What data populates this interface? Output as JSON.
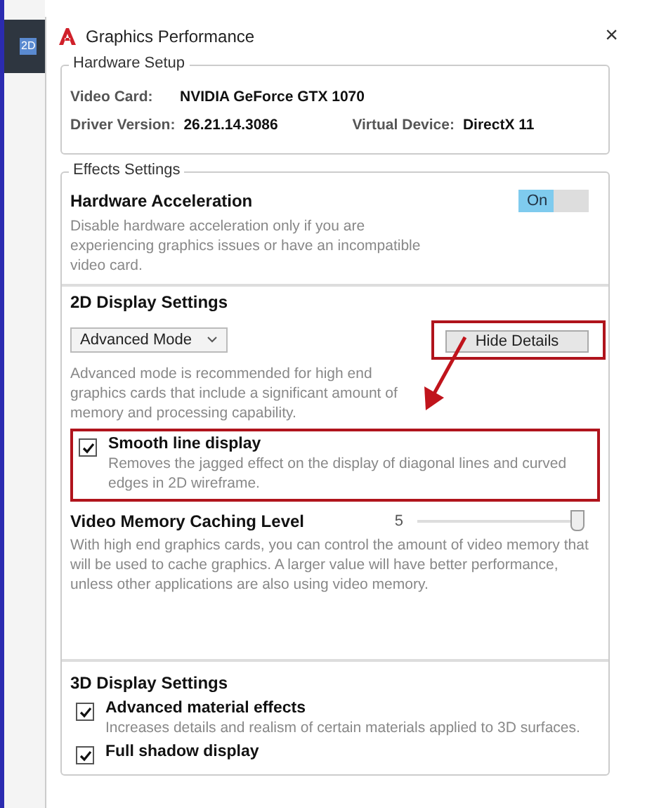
{
  "background_app": {
    "toolbar_label": "2D"
  },
  "window": {
    "title": "Graphics Performance",
    "close": "×"
  },
  "hardware_setup": {
    "title": "Hardware Setup",
    "fields": [
      {
        "label": "Video Card:",
        "value": "NVIDIA GeForce GTX 1070"
      },
      {
        "label": "Driver Version:",
        "value": "26.21.14.3086"
      },
      {
        "label": "Virtual Device:",
        "value": "DirectX 11"
      }
    ]
  },
  "effects_settings": {
    "title": "Effects Settings",
    "hardware_acceleration": {
      "title": "Hardware Acceleration",
      "description": "Disable hardware acceleration only if you are experiencing graphics issues or have an incompatible video card.",
      "toggle_label": "On",
      "on": true
    },
    "display_2d": {
      "title": "2D Display Settings",
      "mode": "Advanced Mode",
      "details_button": "Hide Details",
      "description": "Advanced mode is recommended for high end graphics cards that include a significant amount of memory and processing capability.",
      "options": [
        {
          "title": "Smooth line display",
          "description": "Removes the jagged effect on the display of diagonal lines and curved edges in 2D wireframe.",
          "checked": true
        }
      ],
      "memory_caching": {
        "title": "Video Memory Caching Level",
        "reading": "5",
        "level": 0.96,
        "description": "With high end graphics cards, you can control the amount of video memory that will be used to cache graphics.  A larger value will have better performance, unless other applications are also using video memory."
      }
    },
    "display_3d": {
      "title": "3D Display Settings",
      "options": [
        {
          "title": "Advanced material effects",
          "description": "Increases details and realism of certain materials applied to 3D surfaces.",
          "checked": true
        },
        {
          "title": "Full shadow display",
          "checked": true
        }
      ]
    }
  }
}
